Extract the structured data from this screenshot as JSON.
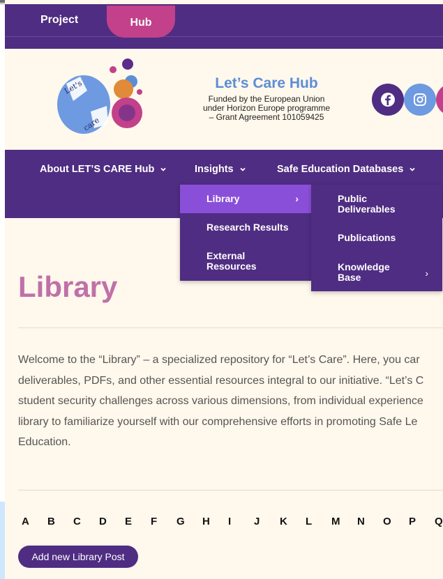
{
  "topbar": {
    "project_label": "Project",
    "hub_label": "Hub"
  },
  "header": {
    "title": "Let’s Care Hub",
    "funded_lines": [
      "Funded by the European Union",
      "under Horizon Europe programme",
      "– Grant Agreement 101059425"
    ],
    "logo_text": "Let's care"
  },
  "social": {
    "facebook": "facebook-icon",
    "instagram": "instagram-icon"
  },
  "nav": {
    "items": [
      {
        "label": "About LET’S CARE Hub"
      },
      {
        "label": "Insights"
      },
      {
        "label": "Safe Education Databases"
      }
    ]
  },
  "dropdown_insights": {
    "items": [
      {
        "label": "Library",
        "has_sub": true
      },
      {
        "label": "Research Results"
      },
      {
        "label": "External Resources"
      }
    ]
  },
  "dropdown_library": {
    "items": [
      {
        "label": "Public Deliverables"
      },
      {
        "label": "Publications"
      },
      {
        "label": "Knowledge Base",
        "has_sub": true
      }
    ]
  },
  "main": {
    "title": "Library",
    "intro_lines": [
      "Welcome to the “Library” – a specialized repository for “Let’s Care”. Here, you car",
      "deliverables, PDFs, and other essential resources integral to our initiative. “Let’s C",
      "student security challenges across various dimensions, from individual experience",
      "library to familiarize yourself with our comprehensive efforts in promoting Safe Le",
      "Education."
    ],
    "alphabet": [
      "A",
      "B",
      "C",
      "D",
      "E",
      "F",
      "G",
      "H",
      "I",
      "J",
      "K",
      "L",
      "M",
      "N",
      "O",
      "P",
      "Q"
    ],
    "add_button_label": "Add new Library Post"
  },
  "colors": {
    "purple": "#4f2d82",
    "pink": "#c2418a",
    "accent": "#8a4fd8",
    "title_pink": "#c070a8",
    "blue": "#5b8ed6"
  }
}
